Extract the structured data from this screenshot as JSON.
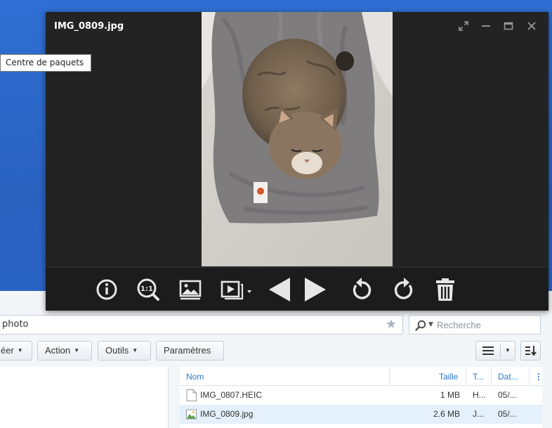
{
  "viewer": {
    "title": "IMG_0809.jpg",
    "controls": [
      "expand-icon",
      "minimize-icon",
      "maximize-icon",
      "close-icon"
    ],
    "toolbar": [
      "info-icon",
      "actual-size-icon",
      "image-icon",
      "slideshow-icon",
      "previous-icon",
      "next-icon",
      "rotate-left-icon",
      "rotate-right-icon",
      "trash-icon"
    ]
  },
  "tooltip": {
    "text": "Centre de paquets"
  },
  "file_station": {
    "path": "photo",
    "search_placeholder": "Recherche",
    "buttons": {
      "create": "éer",
      "action": "Action",
      "tools": "Outils",
      "settings": "Paramètres"
    },
    "columns": {
      "name": "Nom",
      "size": "Taille",
      "type": "T...",
      "date": "Dat..."
    },
    "files": [
      {
        "name": "IMG_0807.HEIC",
        "size": "1 MB",
        "type": "H...",
        "date": "05/..."
      },
      {
        "name": "IMG_0809.jpg",
        "size": "2.6 MB",
        "type": "J...",
        "date": "05/..."
      }
    ]
  },
  "colors": {
    "desktop": "#2b66c8",
    "viewer_bg": "#232323",
    "link_blue": "#2a79c9",
    "selected_row": "#e4f0fb"
  }
}
